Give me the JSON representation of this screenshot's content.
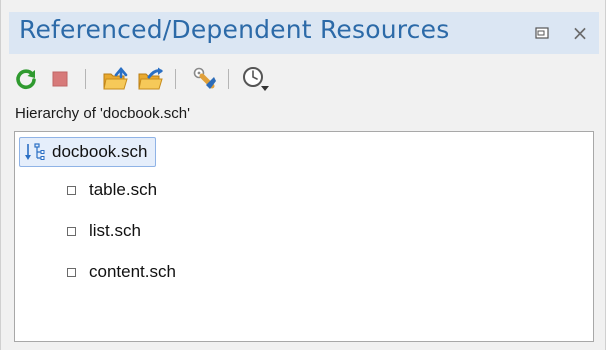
{
  "panel": {
    "title": "Referenced/Dependent Resources",
    "close_glyph": "×",
    "accent_color": "#2c6aa8",
    "title_bg": "#dbe6f3"
  },
  "toolbar": {
    "buttons": [
      {
        "name": "refresh-icon",
        "color": "#2f9a2f"
      },
      {
        "name": "stop-icon",
        "color": "#d77a7a"
      },
      {
        "name": "open-folder-up-icon",
        "color": "#f0b93e"
      },
      {
        "name": "open-folder-arrow-icon",
        "color": "#3a82d8"
      },
      {
        "name": "configure-icon",
        "color": "#e0a03a"
      },
      {
        "name": "history-dropdown-icon",
        "color": "#555555"
      }
    ]
  },
  "hierarchy": {
    "caption": "Hierarchy of 'docbook.sch'",
    "root": {
      "label": "docbook.sch",
      "icon": "hierarchy-tree-icon"
    },
    "children": [
      {
        "label": "table.sch"
      },
      {
        "label": "list.sch"
      },
      {
        "label": "content.sch"
      }
    ]
  }
}
